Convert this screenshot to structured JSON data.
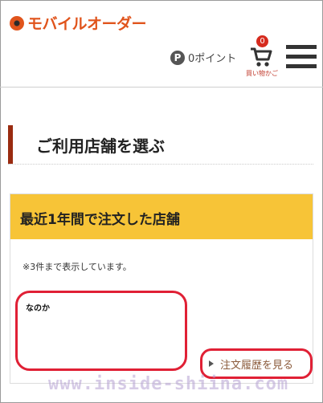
{
  "header": {
    "logo_text": "モバイルオーダー",
    "point_icon": "P",
    "point_text": "0ポイント",
    "cart_count": "0",
    "cart_label": "買い物かご"
  },
  "section": {
    "title": "ご利用店舗を選ぶ"
  },
  "recent": {
    "heading": "最近1年間で注文した店舗",
    "note": "※3件まで表示しています。",
    "store_scribble": "なのか",
    "history_link": "注文履歴を見る"
  },
  "watermark": "www.inside-shiina.com",
  "colors": {
    "brand": "#e0541c",
    "panel_header": "#f7c437",
    "highlight": "#e02035"
  }
}
